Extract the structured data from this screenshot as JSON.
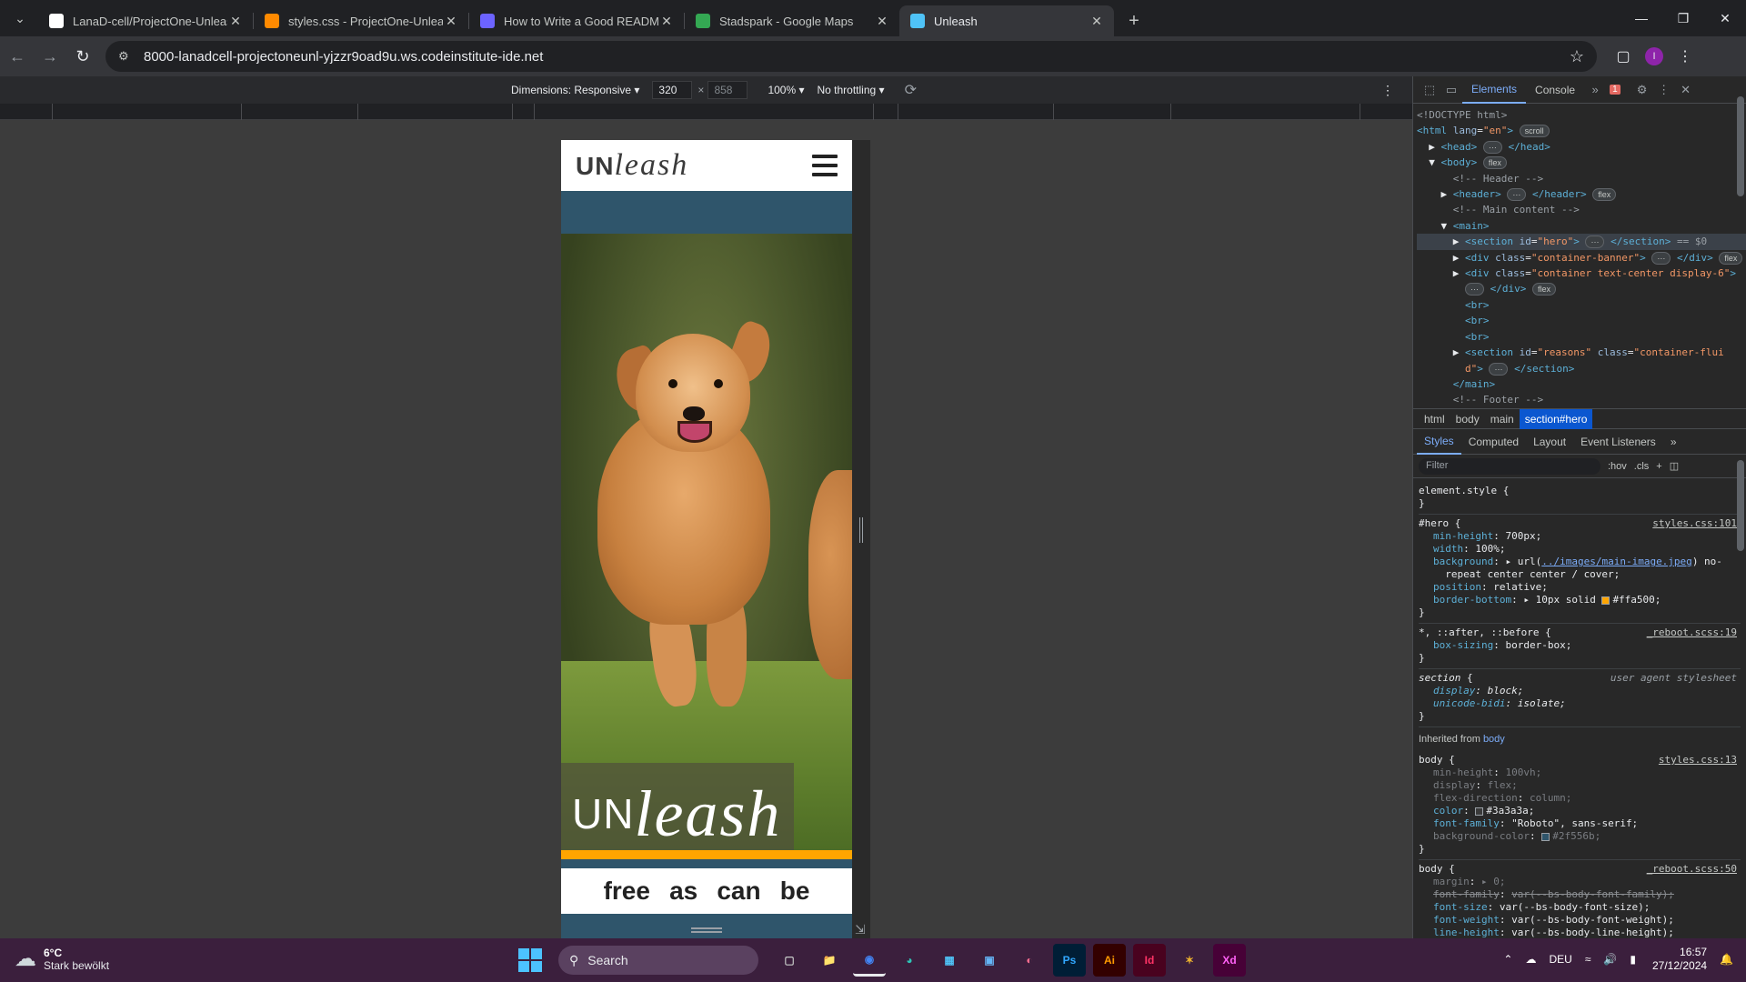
{
  "browser": {
    "tabs": [
      {
        "title": "LanaD-cell/ProjectOne-Unleash",
        "icon": "github-icon",
        "favicon_color": "#ffffff"
      },
      {
        "title": "styles.css - ProjectOne-Unleash",
        "icon": "gitpod-icon",
        "favicon_color": "#ff8a00"
      },
      {
        "title": "How to Write a Good README",
        "icon": "ai-icon",
        "favicon_color": "#6c63ff"
      },
      {
        "title": "Stadspark - Google Maps",
        "icon": "map-pin-icon",
        "favicon_color": "#34a853"
      },
      {
        "title": "Unleash",
        "icon": "ul-icon",
        "favicon_color": "#4fc3f7",
        "active": true
      }
    ],
    "url": "8000-lanadcell-projectoneunl-yjzzr9oad9u.ws.codeinstitute-ide.net",
    "profile_initial": "I"
  },
  "device_toolbar": {
    "dimensions_label": "Dimensions: Responsive ▾",
    "width": "320",
    "height": "858",
    "times": "×",
    "zoom": "100% ▾",
    "throttling": "No throttling ▾"
  },
  "site": {
    "logo_un": "UN",
    "logo_leash": "leash",
    "hero_un": "UN",
    "hero_leash": "leash",
    "tagline": [
      "free",
      "as",
      "can",
      "be"
    ],
    "colors": {
      "accent": "#ffa500",
      "background": "#2f556b",
      "text": "#3a3a3a"
    }
  },
  "devtools": {
    "tabs": {
      "elements": "Elements",
      "console": "Console"
    },
    "error_count": "1",
    "dom_lines": [
      {
        "html": "<span class='cmt'>&lt;!DOCTYPE html&gt;</span>"
      },
      {
        "html": "<span class='tag'>&lt;html</span> <span class='attr'>lang</span>=<span class='val'>\"en\"</span><span class='tag'>&gt;</span> <span class='pill'>scroll</span>"
      },
      {
        "html": "&nbsp;&nbsp;▶ <span class='tag'>&lt;head&gt;</span> <span class='pill'>···</span> <span class='tag'>&lt;/head&gt;</span>"
      },
      {
        "html": "&nbsp;&nbsp;▼ <span class='tag'>&lt;body&gt;</span> <span class='pill'>flex</span>"
      },
      {
        "html": "&nbsp;&nbsp;&nbsp;&nbsp;&nbsp;&nbsp;<span class='cmt'>&lt;!-- Header --&gt;</span>"
      },
      {
        "html": "&nbsp;&nbsp;&nbsp;&nbsp;▶ <span class='tag'>&lt;header&gt;</span> <span class='pill'>···</span> <span class='tag'>&lt;/header&gt;</span> <span class='pill'>flex</span>"
      },
      {
        "html": "&nbsp;&nbsp;&nbsp;&nbsp;&nbsp;&nbsp;<span class='cmt'>&lt;!-- Main content --&gt;</span>"
      },
      {
        "html": "&nbsp;&nbsp;&nbsp;&nbsp;▼ <span class='tag'>&lt;main&gt;</span>"
      },
      {
        "html": "&nbsp;&nbsp;&nbsp;&nbsp;&nbsp;&nbsp;▶ <span class='tag'>&lt;section</span> <span class='attr'>id</span>=<span class='val'>\"hero\"</span><span class='tag'>&gt;</span> <span class='pill'>···</span> <span class='tag'>&lt;/section&gt;</span> <span class='cmt'>== $0</span>",
        "selected": true
      },
      {
        "html": "&nbsp;&nbsp;&nbsp;&nbsp;&nbsp;&nbsp;▶ <span class='tag'>&lt;div</span> <span class='attr'>class</span>=<span class='val'>\"container-banner\"</span><span class='tag'>&gt;</span> <span class='pill'>···</span> <span class='tag'>&lt;/div&gt;</span> <span class='pill'>flex</span>"
      },
      {
        "html": "&nbsp;&nbsp;&nbsp;&nbsp;&nbsp;&nbsp;▶ <span class='tag'>&lt;div</span> <span class='attr'>class</span>=<span class='val'>\"container text-center display-6\"</span><span class='tag'>&gt;</span>"
      },
      {
        "html": "&nbsp;&nbsp;&nbsp;&nbsp;&nbsp;&nbsp;&nbsp;&nbsp;<span class='pill'>···</span> <span class='tag'>&lt;/div&gt;</span> <span class='pill'>flex</span>"
      },
      {
        "html": "&nbsp;&nbsp;&nbsp;&nbsp;&nbsp;&nbsp;&nbsp;&nbsp;<span class='tag'>&lt;br&gt;</span>"
      },
      {
        "html": "&nbsp;&nbsp;&nbsp;&nbsp;&nbsp;&nbsp;&nbsp;&nbsp;<span class='tag'>&lt;br&gt;</span>"
      },
      {
        "html": "&nbsp;&nbsp;&nbsp;&nbsp;&nbsp;&nbsp;&nbsp;&nbsp;<span class='tag'>&lt;br&gt;</span>"
      },
      {
        "html": "&nbsp;&nbsp;&nbsp;&nbsp;&nbsp;&nbsp;▶ <span class='tag'>&lt;section</span> <span class='attr'>id</span>=<span class='val'>\"reasons\"</span> <span class='attr'>class</span>=<span class='val'>\"container-flui</span>"
      },
      {
        "html": "&nbsp;&nbsp;&nbsp;&nbsp;&nbsp;&nbsp;&nbsp;&nbsp;<span class='val'>d\"</span><span class='tag'>&gt;</span> <span class='pill'>···</span> <span class='tag'>&lt;/section&gt;</span>"
      },
      {
        "html": "&nbsp;&nbsp;&nbsp;&nbsp;&nbsp;&nbsp;<span class='tag'>&lt;/main&gt;</span>"
      },
      {
        "html": "&nbsp;&nbsp;&nbsp;&nbsp;&nbsp;&nbsp;<span class='cmt'>&lt;!-- Footer --&gt;</span>"
      }
    ],
    "breadcrumb": [
      "html",
      "body",
      "main",
      "section#hero"
    ],
    "subtabs": [
      "Styles",
      "Computed",
      "Layout",
      "Event Listeners"
    ],
    "filter_placeholder": "Filter",
    "filter_opts": [
      ":hov",
      ".cls"
    ],
    "inherited_label": "Inherited from",
    "inherited_from": "body"
  },
  "taskbar": {
    "temp": "6°C",
    "weather": "Stark bewölkt",
    "search": "Search",
    "lang": "DEU",
    "time": "16:57",
    "date": "27/12/2024"
  }
}
